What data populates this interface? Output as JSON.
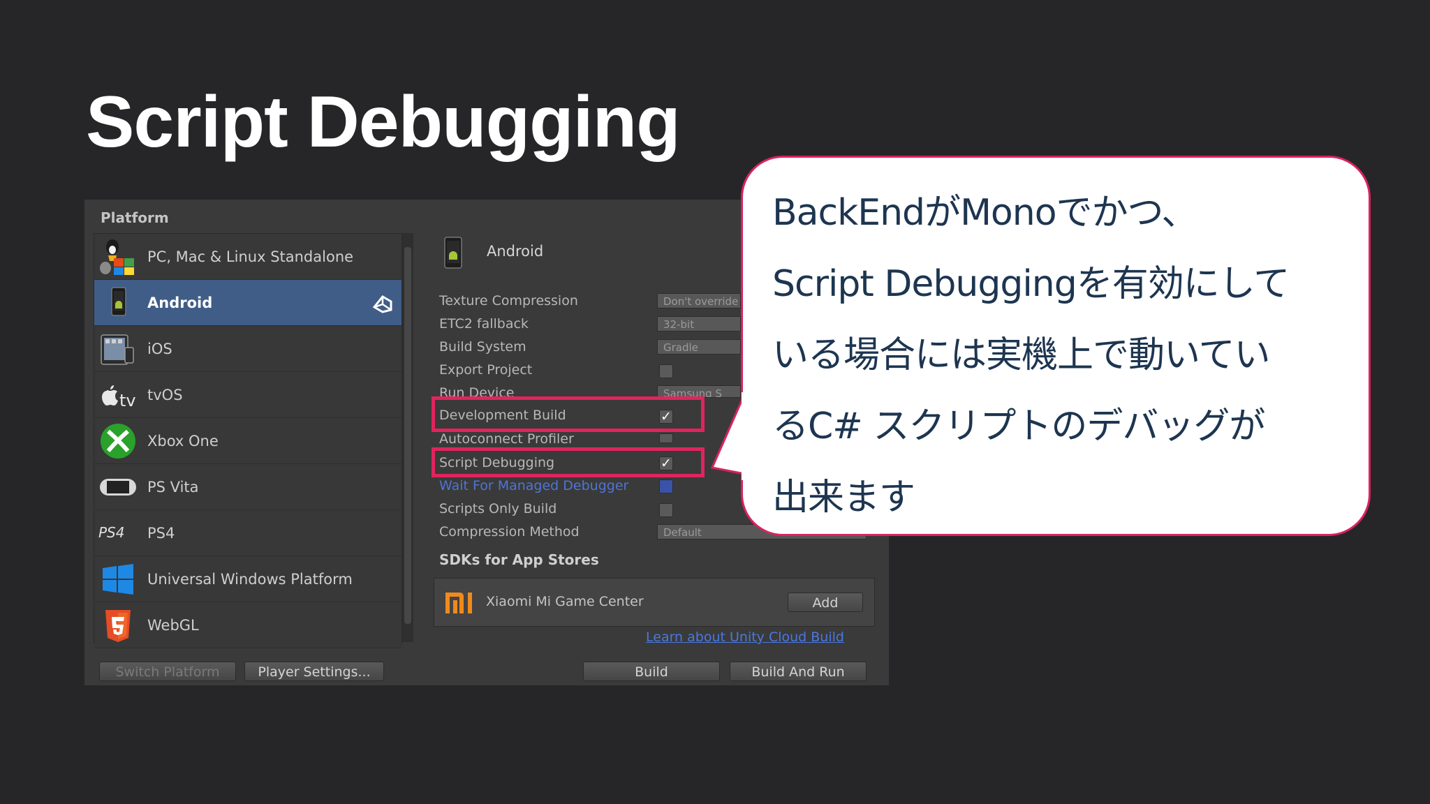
{
  "slide": {
    "title": "Script Debugging"
  },
  "window": {
    "platform_heading": "Platform",
    "platforms": [
      {
        "label": "PC, Mac & Linux Standalone",
        "icon": "standalone-icon",
        "selected": false
      },
      {
        "label": "Android",
        "icon": "android-icon",
        "selected": true
      },
      {
        "label": "iOS",
        "icon": "ios-icon",
        "selected": false
      },
      {
        "label": "tvOS",
        "icon": "appletv-icon",
        "selected": false
      },
      {
        "label": "Xbox One",
        "icon": "xbox-icon",
        "selected": false
      },
      {
        "label": "PS Vita",
        "icon": "psvita-icon",
        "selected": false
      },
      {
        "label": "PS4",
        "icon": "ps4-icon",
        "selected": false
      },
      {
        "label": "Universal Windows Platform",
        "icon": "windows-icon",
        "selected": false
      },
      {
        "label": "WebGL",
        "icon": "html5-icon",
        "selected": false
      }
    ],
    "buttons": {
      "switch_platform": "Switch Platform",
      "player_settings": "Player Settings...",
      "build": "Build",
      "build_and_run": "Build And Run",
      "add": "Add"
    },
    "settings": {
      "title": "Android",
      "texture_compression": {
        "label": "Texture Compression",
        "value": "Don't override"
      },
      "etc2_fallback": {
        "label": "ETC2 fallback",
        "value": "32-bit"
      },
      "build_system": {
        "label": "Build System",
        "value": "Gradle"
      },
      "export_project": {
        "label": "Export Project",
        "checked": false
      },
      "run_device": {
        "label": "Run Device",
        "value": "Samsung S"
      },
      "development_build": {
        "label": "Development Build",
        "checked": true
      },
      "autoconnect_profiler": {
        "label": "Autoconnect Profiler",
        "checked": false
      },
      "script_debugging": {
        "label": "Script Debugging",
        "checked": true
      },
      "wait_for_managed_debugger": {
        "label": "Wait For Managed Debugger",
        "checked": false
      },
      "scripts_only_build": {
        "label": "Scripts Only Build",
        "checked": false
      },
      "compression_method": {
        "label": "Compression Method",
        "value": "Default"
      }
    },
    "sdk_heading": "SDKs for App Stores",
    "sdk_item": "Xiaomi Mi Game Center",
    "cloud_link": "Learn about Unity Cloud Build"
  },
  "callout": {
    "lines": [
      "BackEndがMonoでかつ、",
      "Script Debuggingを有効にして",
      "いる場合には実機上で動いてい",
      "るC# スクリプトのデバッグが",
      "出来ます"
    ]
  },
  "colors": {
    "background": "#262628",
    "highlight": "#e0245e",
    "selected_row": "#3f5d87",
    "callout_text": "#1d3550"
  }
}
